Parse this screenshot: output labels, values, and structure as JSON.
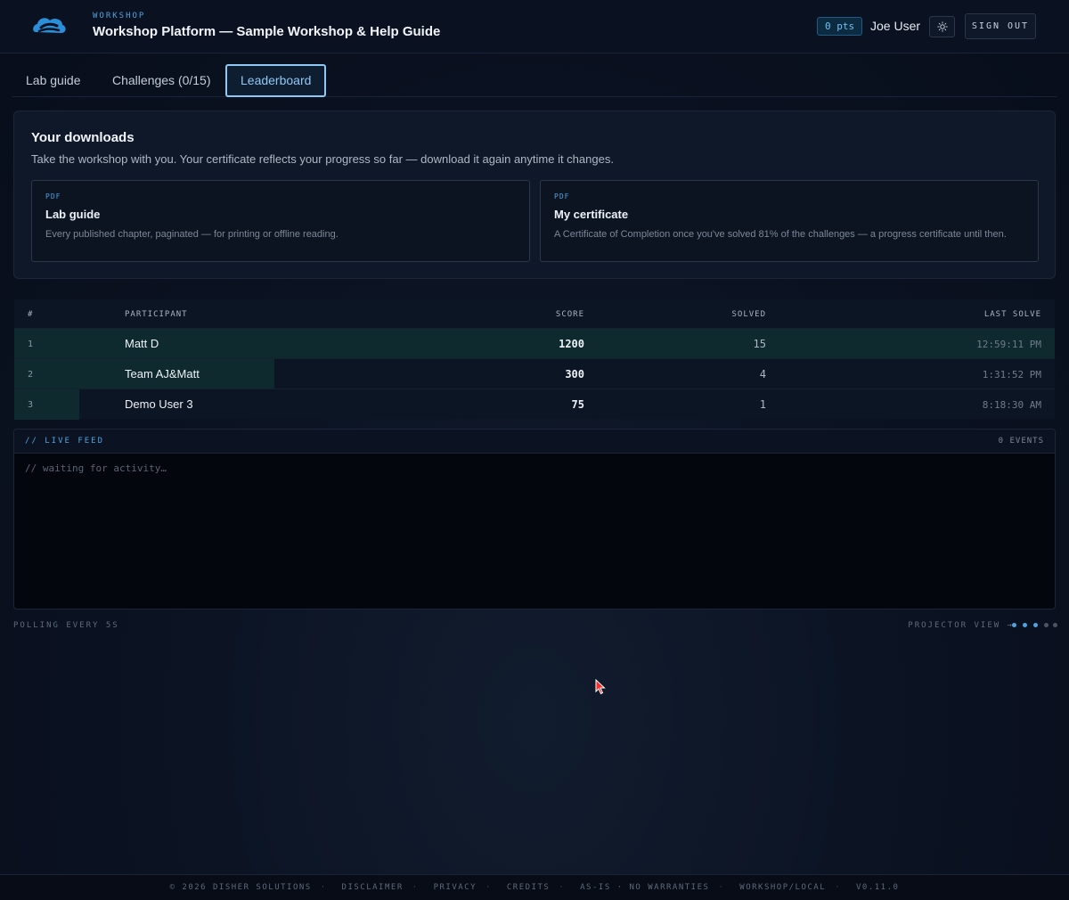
{
  "header": {
    "eyebrow": "WORKSHOP",
    "title": "Workshop Platform — Sample Workshop & Help Guide",
    "points": "0 pts",
    "user": "Joe User",
    "sign_out": "SIGN OUT",
    "logo_icon": "cloud-logo-icon",
    "theme_icon": "sun-icon"
  },
  "tabs": [
    {
      "label": "Lab guide",
      "active": false
    },
    {
      "label": "Challenges (0/15)",
      "active": false
    },
    {
      "label": "Leaderboard",
      "active": true
    }
  ],
  "downloads": {
    "title": "Your downloads",
    "subtitle": "Take the workshop with you. Your certificate reflects your progress so far — download it again anytime it changes.",
    "cards": [
      {
        "tag": "PDF",
        "name": "Lab guide",
        "desc": "Every published chapter, paginated — for printing or offline reading."
      },
      {
        "tag": "PDF",
        "name": "My certificate",
        "desc": "A Certificate of Completion once you've solved 81% of the challenges — a progress certificate until then."
      }
    ]
  },
  "leaderboard": {
    "columns": {
      "rank": "#",
      "participant": "PARTICIPANT",
      "score": "SCORE",
      "solved": "SOLVED",
      "last_solve": "LAST SOLVE"
    },
    "rows": [
      {
        "rank": "1",
        "participant": "Matt D",
        "score": "1200",
        "solved": "15",
        "last_solve": "12:59:11 PM",
        "share": 1.0
      },
      {
        "rank": "2",
        "participant": "Team AJ&Matt",
        "score": "300",
        "solved": "4",
        "last_solve": "1:31:52 PM",
        "share": 0.25
      },
      {
        "rank": "3",
        "participant": "Demo User 3",
        "score": "75",
        "solved": "1",
        "last_solve": "8:18:30 AM",
        "share": 0.0625
      }
    ]
  },
  "feed": {
    "title": "// LIVE FEED",
    "count": "0 EVENTS",
    "empty": "// waiting for activity…"
  },
  "status": {
    "polling": "POLLING EVERY 5S",
    "projector": "PROJECTOR VIEW →",
    "dots": [
      "#4ea3e0",
      "#4ea3e0",
      "#4ea3e0",
      "#4a5466",
      "#4a5466"
    ]
  },
  "footer": {
    "items": [
      "© 2026 DISHER SOLUTIONS",
      "DISCLAIMER",
      "PRIVACY",
      "CREDITS",
      "AS-IS · NO WARRANTIES",
      "WORKSHOP/LOCAL",
      "V0.11.0"
    ]
  }
}
